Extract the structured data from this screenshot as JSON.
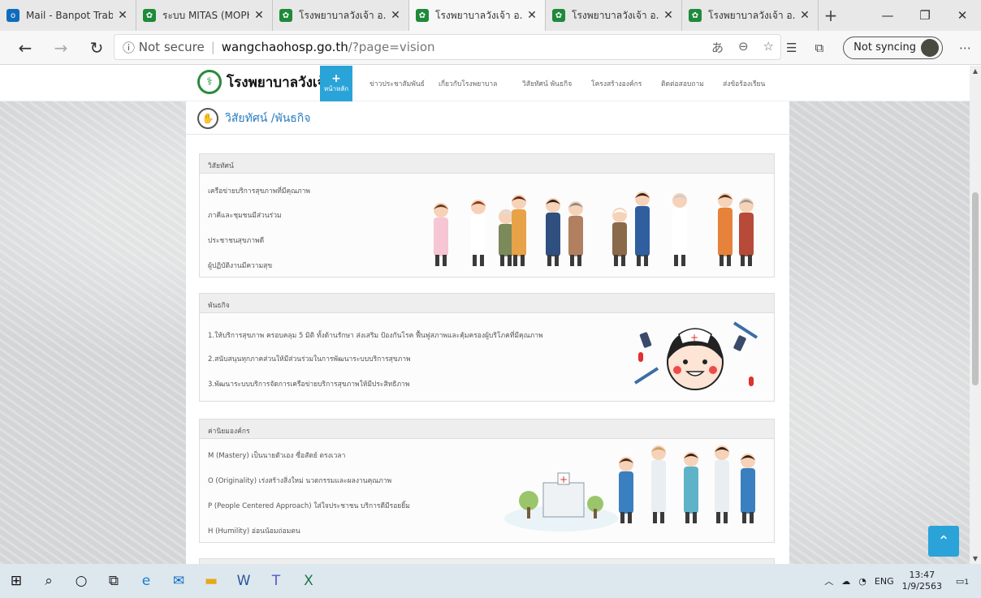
{
  "browser": {
    "tabs": [
      {
        "title": "Mail - Banpot Trabue",
        "favicon": "outlook-icon",
        "color": "#0f6cbd"
      },
      {
        "title": "ระบบ MITAS (MOPH",
        "favicon": "moph-icon",
        "color": "#1e8a3a"
      },
      {
        "title": "โรงพยาบาลวังเจ้า อ.วังเจ้",
        "favicon": "moph-icon",
        "color": "#1e8a3a"
      },
      {
        "title": "โรงพยาบาลวังเจ้า อ.วังเจ้",
        "favicon": "moph-icon",
        "color": "#1e8a3a",
        "active": true
      },
      {
        "title": "โรงพยาบาลวังเจ้า อ.วังเจ้",
        "favicon": "moph-icon",
        "color": "#1e8a3a"
      },
      {
        "title": "โรงพยาบาลวังเจ้า อ.วังเจ้",
        "favicon": "moph-icon",
        "color": "#1e8a3a"
      }
    ],
    "tab_close": "✕",
    "new_tab": "+",
    "security_label": "Not secure",
    "url_host": "wangchaohosp.go.th",
    "url_path": "/?page=vision",
    "sync_label": "Not syncing"
  },
  "site": {
    "name": "โรงพยาบาลวังเจ้า",
    "nav": [
      {
        "label": "หน้าหลัก"
      },
      {
        "label": "ข่าวประชาสัมพันธ์"
      },
      {
        "label": "เกี่ยวกับโรงพยาบาล"
      },
      {
        "label": "วิสัยทัศน์ พันธกิจ"
      },
      {
        "label": "โครงสร้างองค์กร"
      },
      {
        "label": "ติดต่อสอบถาม"
      },
      {
        "label": "ส่งข้อร้องเรียน"
      }
    ],
    "page_title": "วิสัยทัศน์ /พันธกิจ"
  },
  "sections": {
    "vision": {
      "heading": "วิสัยทัศน์",
      "items": [
        "เครือข่ายบริการสุขภาพที่มีคุณภาพ",
        "ภาคีและชุมชนมีส่วนร่วม",
        "ประชาชนสุขภาพดี",
        "ผู้ปฏิบัติงานมีความสุข"
      ]
    },
    "mission": {
      "heading": "พันธกิจ",
      "items": [
        "1.ให้บริการสุขภาพ ครอบคลุม 5 มิติ ทั้งด้านรักษา ส่งเสริม ป้องกันโรค ฟื้นฟูสภาพและคุ้มครองผู้บริโภคที่มีคุณภาพ",
        "2.สนับสนุนทุกภาคส่วนให้มีส่วนร่วมในการพัฒนาระบบบริการสุขภาพ",
        "3.พัฒนาระบบบริการจัดการเครือข่ายบริการสุขภาพให้มีประสิทธิภาพ"
      ]
    },
    "values": {
      "heading": "ค่านิยมองค์กร",
      "items": [
        "M (Mastery) เป็นนายตัวเอง ซื่อสัตย์ ตรงเวลา",
        "O (Originality) เร่งสร้างสิ่งใหม่ นวตกรรมและผลงานคุณภาพ",
        "P (People Centered Approach) ใส่ใจประชาชน บริการดีมีรอยยิ้ม",
        "H (Humility) อ่อนน้อมถ่อมตน"
      ]
    }
  },
  "taskbar": {
    "lang": "ENG",
    "time": "13:47",
    "date": "1/9/2563",
    "notif_count": "1"
  }
}
